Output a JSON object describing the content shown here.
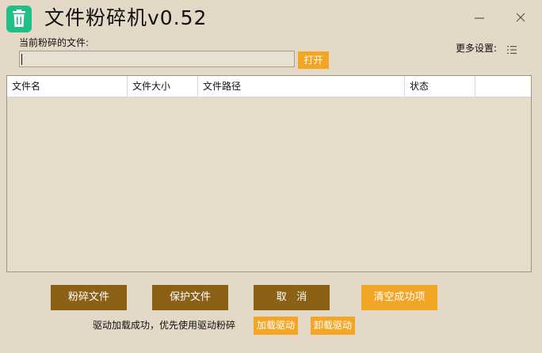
{
  "app": {
    "title": "文件粉碎机v0.52"
  },
  "window": {
    "minimize_icon": "minimize-icon",
    "close_icon": "close-icon"
  },
  "file": {
    "label": "当前粉碎的文件:",
    "value": "",
    "open_label": "打开"
  },
  "settings": {
    "label": "更多设置:",
    "icon": "list-icon"
  },
  "table": {
    "columns": [
      "文件名",
      "文件大小",
      "文件路径",
      "状态",
      ""
    ],
    "rows": []
  },
  "actions": {
    "shred_label": "粉碎文件",
    "protect_label": "保护文件",
    "cancel_label": "取   消",
    "clear_label": "清空成功项"
  },
  "driver": {
    "status": "驱动加载成功，优先使用驱动粉碎",
    "load_label": "加载驱动",
    "unload_label": "卸载驱动"
  },
  "colors": {
    "background": "#e4d9c6",
    "accent_orange": "#f3a626",
    "accent_brown": "#8c6016",
    "app_icon_green": "#1fbf86"
  }
}
